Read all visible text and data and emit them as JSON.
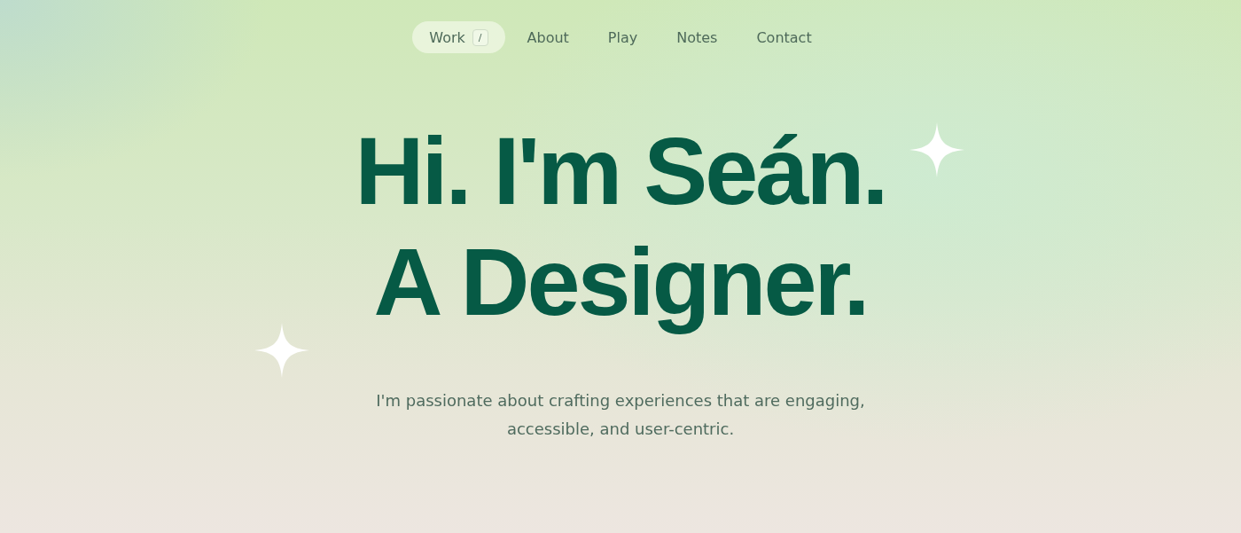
{
  "nav": [
    {
      "label": "Work",
      "selected": true,
      "shortcut": "/"
    },
    {
      "label": "About",
      "selected": false
    },
    {
      "label": "Play",
      "selected": false
    },
    {
      "label": "Notes",
      "selected": false
    },
    {
      "label": "Contact",
      "selected": false
    }
  ],
  "hero": {
    "headline": [
      "Hi. I'm Seán.",
      "A Designer."
    ],
    "intro": "I'm passionate about crafting experiences that are engaging, accessible, and user-centric."
  }
}
